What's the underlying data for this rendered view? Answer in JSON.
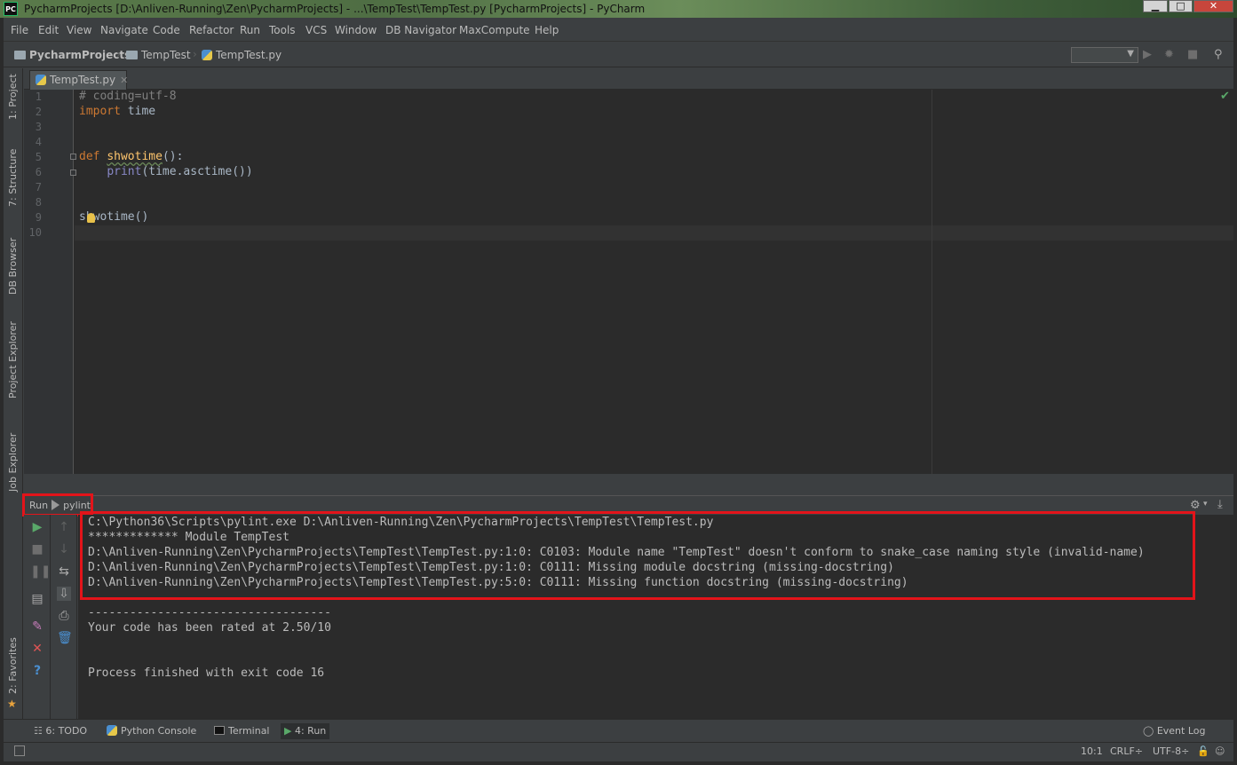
{
  "window": {
    "title": "PycharmProjects [D:\\Anliven-Running\\Zen\\PycharmProjects] - ...\\TempTest\\TempTest.py [PycharmProjects] - PyCharm",
    "logo": "PC",
    "minimize": "▁",
    "maximize": "□",
    "close": "✕"
  },
  "menu": [
    "File",
    "Edit",
    "View",
    "Navigate",
    "Code",
    "Refactor",
    "Run",
    "Tools",
    "VCS",
    "Window",
    "DB Navigator",
    "MaxCompute",
    "Help"
  ],
  "breadcrumb": {
    "project": "PycharmProjects",
    "folder": "TempTest",
    "file": "TempTest.py"
  },
  "left_tool_windows": [
    "1: Project",
    "7: Structure",
    "DB Browser",
    "Project Explorer",
    "Job Explorer",
    "2: Favorites"
  ],
  "editor": {
    "tab": "TempTest.py",
    "line_numbers": [
      "1",
      "2",
      "3",
      "4",
      "5",
      "6",
      "7",
      "8",
      "9",
      "10"
    ],
    "lines": {
      "l1_comment": "# coding=utf-8",
      "l2_kw": "import",
      "l2_rest": " time",
      "l5_kw": "def",
      "l5_fn": "shwotime",
      "l5_rest": "():",
      "l6_indent": "    ",
      "l6_builtin": "print",
      "l6_rest": "(time.asctime())",
      "l9_code": "shwotime()"
    }
  },
  "run_panel": {
    "label": "Run",
    "config": "pylint",
    "console_lines": [
      "C:\\Python36\\Scripts\\pylint.exe D:\\Anliven-Running\\Zen\\PycharmProjects\\TempTest\\TempTest.py",
      "************* Module TempTest",
      "D:\\Anliven-Running\\Zen\\PycharmProjects\\TempTest\\TempTest.py:1:0: C0103: Module name \"TempTest\" doesn't conform to snake_case naming style (invalid-name)",
      "D:\\Anliven-Running\\Zen\\PycharmProjects\\TempTest\\TempTest.py:1:0: C0111: Missing module docstring (missing-docstring)",
      "D:\\Anliven-Running\\Zen\\PycharmProjects\\TempTest\\TempTest.py:5:0: C0111: Missing function docstring (missing-docstring)",
      "",
      "-----------------------------------",
      "Your code has been rated at 2.50/10",
      "",
      "",
      "Process finished with exit code 16"
    ]
  },
  "bottom_tabs": {
    "todo": "6: TODO",
    "python_console": "Python Console",
    "terminal": "Terminal",
    "run": "4: Run",
    "event_log": "Event Log"
  },
  "status": {
    "position": "10:1",
    "line_sep": "CRLF÷",
    "encoding": "UTF-8÷"
  },
  "colors": {
    "accent_red_highlight": "#e3141a",
    "background": "#2b2b2b",
    "panel": "#3c3f41"
  }
}
